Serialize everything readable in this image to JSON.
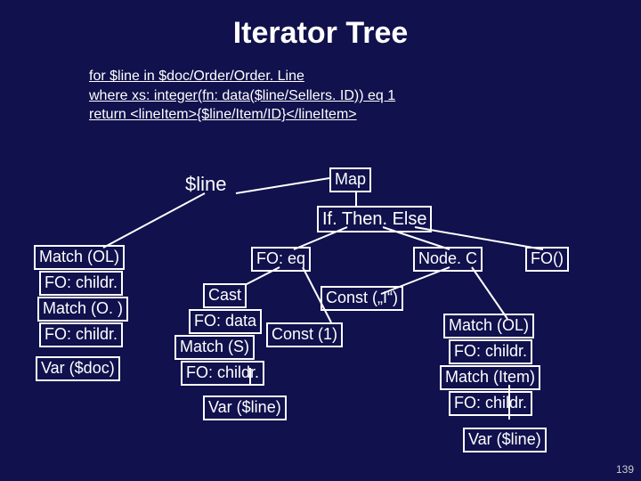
{
  "title": "Iterator Tree",
  "code": {
    "l1": "for $line in $doc/Order/Order. Line",
    "l2": "where xs: integer(fn: data($line/Sellers. ID)) eq 1",
    "l3": "return <lineItem>{$line/Item/ID}</lineItem>"
  },
  "nodes": {
    "line": "$line",
    "map": "Map",
    "ifthenelse": "If. Then. Else",
    "matchOL1": "Match (OL)",
    "foChildr1": "FO: childr.",
    "matchO": "Match (O. )",
    "foChildr2": "FO: childr.",
    "varDoc": "Var ($doc)",
    "foEq": "FO: eq",
    "cast": "Cast",
    "foData": "FO: data",
    "matchS": "Match (S)",
    "foChildr3": "FO: childr.",
    "varLine1": "Var ($line)",
    "const1": "Const (1)",
    "nodeC": "Node. C",
    "constI": "Const („I“)",
    "fo": "FO()",
    "matchOL2": "Match (OL)",
    "foChildr4": "FO: childr.",
    "matchItem": "Match (Item)",
    "foChildr5": "FO: childr.",
    "varLine2": "Var ($line)"
  },
  "pageNumber": "139"
}
